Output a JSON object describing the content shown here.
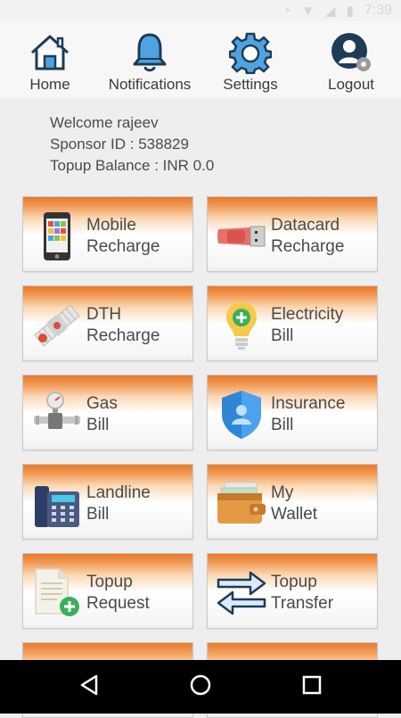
{
  "status": {
    "time": "7:39"
  },
  "nav": [
    {
      "label": "Home"
    },
    {
      "label": "Notifications"
    },
    {
      "label": "Settings"
    },
    {
      "label": "Logout"
    }
  ],
  "info": {
    "welcome": "Welcome rajeev",
    "sponsor": "Sponsor ID : 538829",
    "balance": "Topup Balance : INR 0.0"
  },
  "tiles": [
    {
      "line1": "Mobile",
      "line2": "Recharge",
      "icon": "mobile-phone-icon"
    },
    {
      "line1": "Datacard",
      "line2": "Recharge",
      "icon": "usb-datacard-icon"
    },
    {
      "line1": "DTH",
      "line2": "Recharge",
      "icon": "satellite-icon"
    },
    {
      "line1": "Electricity",
      "line2": "Bill",
      "icon": "light-bulb-icon"
    },
    {
      "line1": "Gas",
      "line2": "Bill",
      "icon": "gas-meter-icon"
    },
    {
      "line1": "Insurance",
      "line2": "Bill",
      "icon": "shield-icon"
    },
    {
      "line1": "Landline",
      "line2": "Bill",
      "icon": "telephone-icon"
    },
    {
      "line1": "My",
      "line2": "Wallet",
      "icon": "wallet-icon"
    },
    {
      "line1": "Topup",
      "line2": "Request",
      "icon": "document-add-icon"
    },
    {
      "line1": "Topup",
      "line2": "Transfer",
      "icon": "transfer-arrows-icon"
    }
  ]
}
